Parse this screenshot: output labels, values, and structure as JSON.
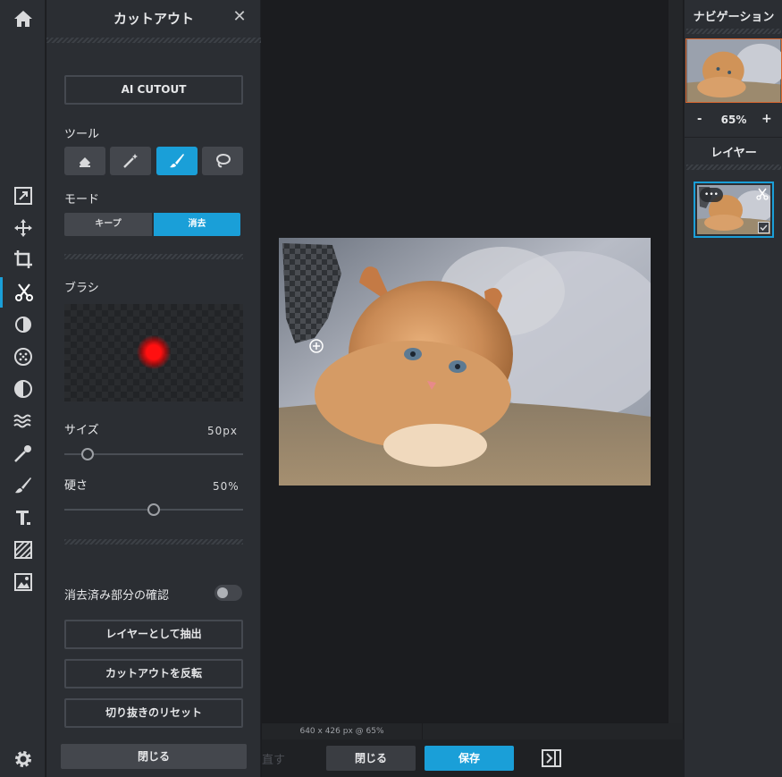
{
  "panel": {
    "title": "カットアウト",
    "close": "✕",
    "ai_cutout": "AI CUTOUT",
    "tools_label": "ツール",
    "mode_label": "モード",
    "mode_keep": "キープ",
    "mode_erase": "消去",
    "brush_label": "ブラシ",
    "size_label": "サイズ",
    "size_value": "50px",
    "size_fraction": 0.13,
    "hardness_label": "硬さ",
    "hardness_value": "50%",
    "hardness_fraction": 0.5,
    "erased_check_label": "消去済み部分の確認",
    "extract_layer": "レイヤーとして抽出",
    "invert_cutout": "カットアウトを反転",
    "reset_cutout": "切り抜きのリセット",
    "close_button": "閉じる"
  },
  "canvas": {
    "status": "640 x 426 px @ 65%"
  },
  "bottom": {
    "redo_partial": "直す",
    "close": "閉じる",
    "save": "保存"
  },
  "right": {
    "navigation_title": "ナビゲーション",
    "zoom_minus": "-",
    "zoom_value": "65%",
    "zoom_plus": "+",
    "layers_title": "レイヤー",
    "layer_menu": "•••"
  },
  "colors": {
    "accent": "#1a9fd8",
    "panel_bg": "#2b2e33",
    "canvas_bg": "#1b1c1f"
  }
}
